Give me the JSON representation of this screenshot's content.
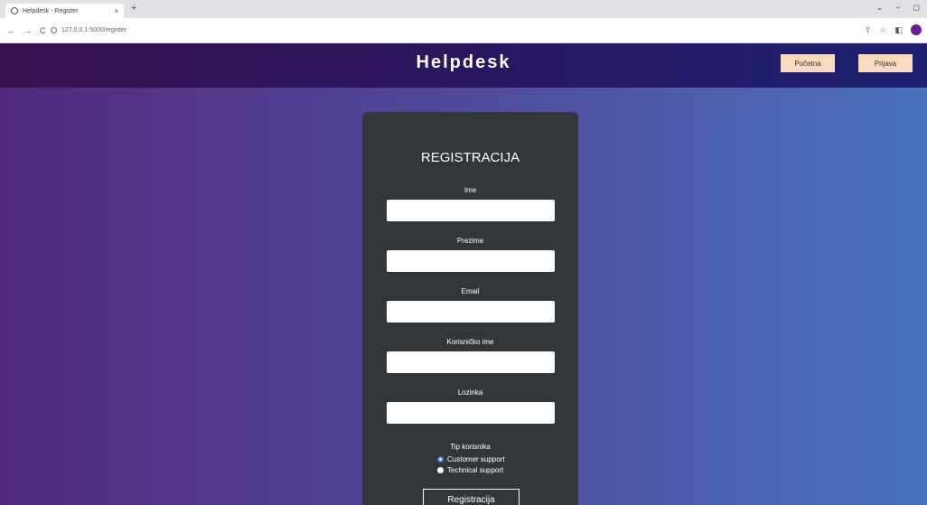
{
  "browser": {
    "tab_title": "Helpdesk - Register",
    "tab_close": "×",
    "new_tab": "+",
    "url": "127.0.0.1:5000/register",
    "win_min": "−",
    "win_max": "◻",
    "win_down": "⌄"
  },
  "header": {
    "brand": "Helpdesk",
    "home_button": "Početna",
    "login_button": "Prijava"
  },
  "form": {
    "title": "REGISTRACIJA",
    "fields": [
      {
        "label": "Ime",
        "value": ""
      },
      {
        "label": "Prezime",
        "value": ""
      },
      {
        "label": "Email",
        "value": ""
      },
      {
        "label": "Korisničko ime",
        "value": ""
      },
      {
        "label": "Lozinka",
        "value": ""
      }
    ],
    "user_type_label": "Tip korisnika",
    "user_types": [
      {
        "label": "Customer support",
        "checked": true
      },
      {
        "label": "Technical support",
        "checked": false
      }
    ],
    "submit_label": "Registracija"
  },
  "colors": {
    "header_bg": "#2a1660",
    "card_bg": "#333638",
    "button_bg": "#fbd9bd",
    "radio_accent": "#2f7de1"
  }
}
